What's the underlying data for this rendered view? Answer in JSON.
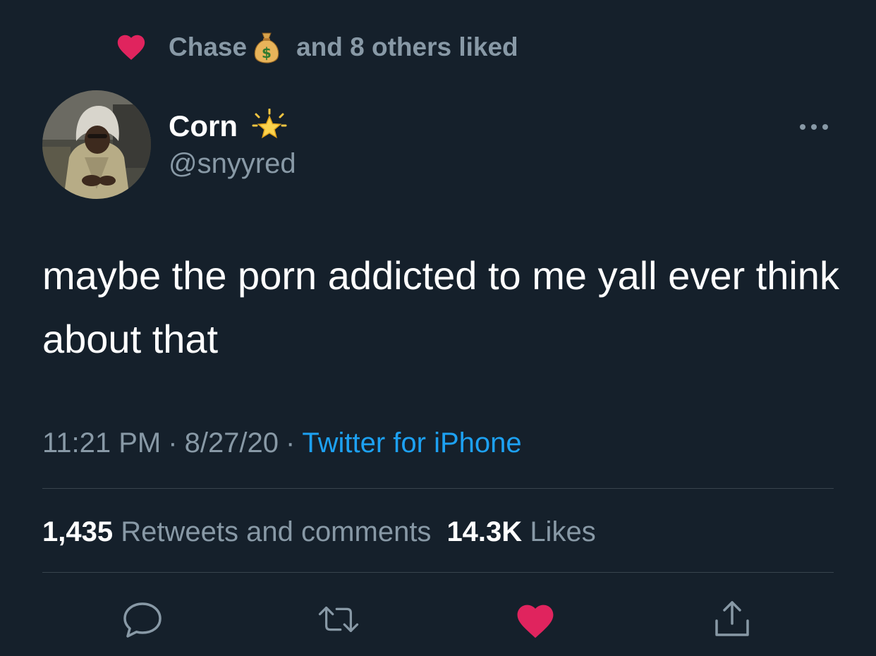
{
  "social_context": {
    "liker_name": "Chase",
    "liker_emoji_icon": "money-bag-icon",
    "suffix": "and 8 others liked"
  },
  "author": {
    "display_name": "Corn",
    "badge_emoji_icon": "glowing-star-icon",
    "handle": "@snyyred"
  },
  "tweet": {
    "text": "maybe the porn addicted to me yall ever think about that",
    "time": "11:21 PM",
    "date": "8/27/20",
    "separator": "·",
    "source": "Twitter for iPhone"
  },
  "stats": {
    "retweets_count": "1,435",
    "retweets_label": "Retweets and comments",
    "likes_count": "14.3K",
    "likes_label": "Likes"
  },
  "actions": [
    "reply-icon",
    "retweet-icon",
    "like-icon",
    "share-icon"
  ],
  "colors": {
    "background": "#15202b",
    "text_primary": "#ffffff",
    "text_secondary": "#8899a6",
    "link": "#1da1f2",
    "like": "#e0245e",
    "divider": "#38444d"
  }
}
